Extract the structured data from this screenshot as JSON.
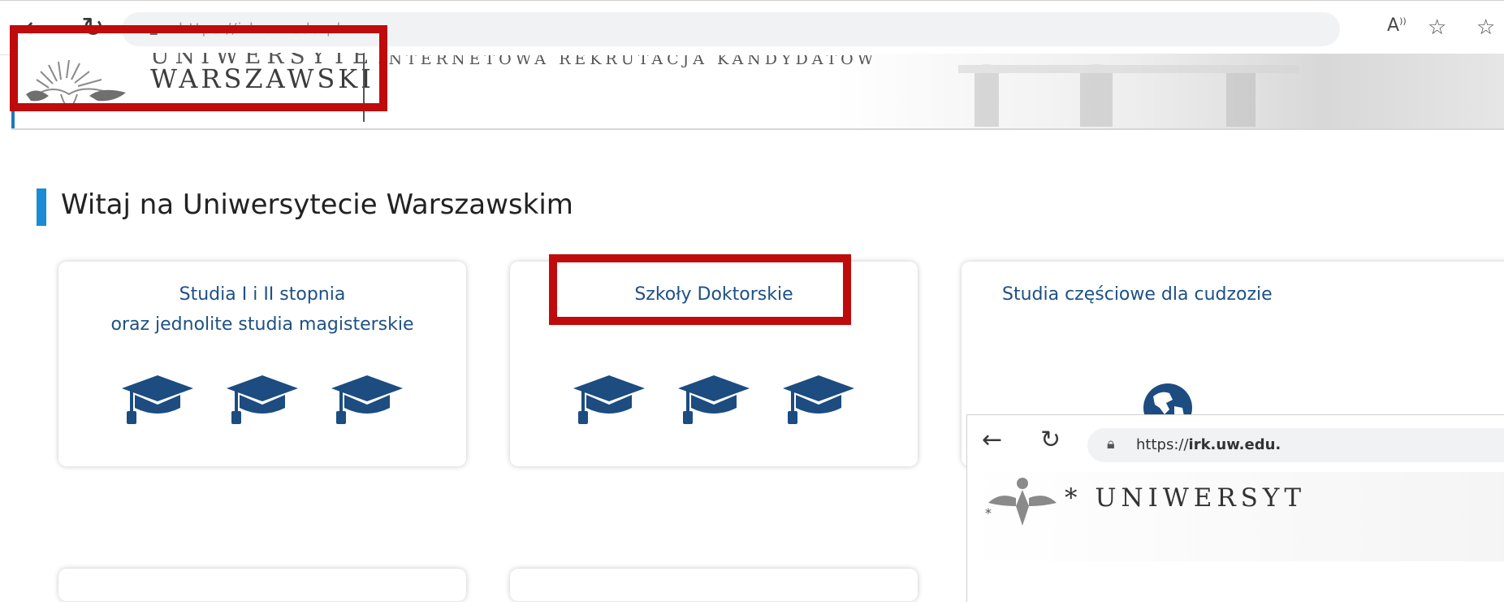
{
  "browser": {
    "back_icon": "arrow-left-icon",
    "reload_icon": "reload-icon",
    "lock_icon": "lock-icon",
    "url": "https://irk.uw.edu.pl",
    "read_aloud_icon": "read-aloud-icon",
    "favorite_icon": "star-plus-icon",
    "favorites_list_icon": "favorites-list-icon"
  },
  "header": {
    "uw_top": "UNIWERSYTET",
    "uw_name": "WARSZAWSKI",
    "irk_title": "INTERNETOWA REKRUTACJA KANDYDATÓW"
  },
  "page": {
    "title": "Witaj na Uniwersytecie Warszawskim",
    "accent_color": "#1b8bd4"
  },
  "cards": [
    {
      "label_line1": "Studia I i II stopnia",
      "label_line2": "oraz jednolite studia magisterskie",
      "icon": "graduation-cap-icon"
    },
    {
      "label_line1": "Szkoły Doktorskie",
      "label_line2": "",
      "icon": "graduation-cap-icon"
    },
    {
      "label_line1": "Studia częściowe dla cudzozie",
      "label_line2": "",
      "icon": "globe-icon"
    }
  ],
  "overlay": {
    "url_prefix": "https://",
    "url_domain": "irk.uw.edu.",
    "uw_name": "* UNIWERSYT"
  },
  "colors": {
    "highlight": "#bf0b0b",
    "link": "#1d5185",
    "icon": "#1c4c80"
  }
}
